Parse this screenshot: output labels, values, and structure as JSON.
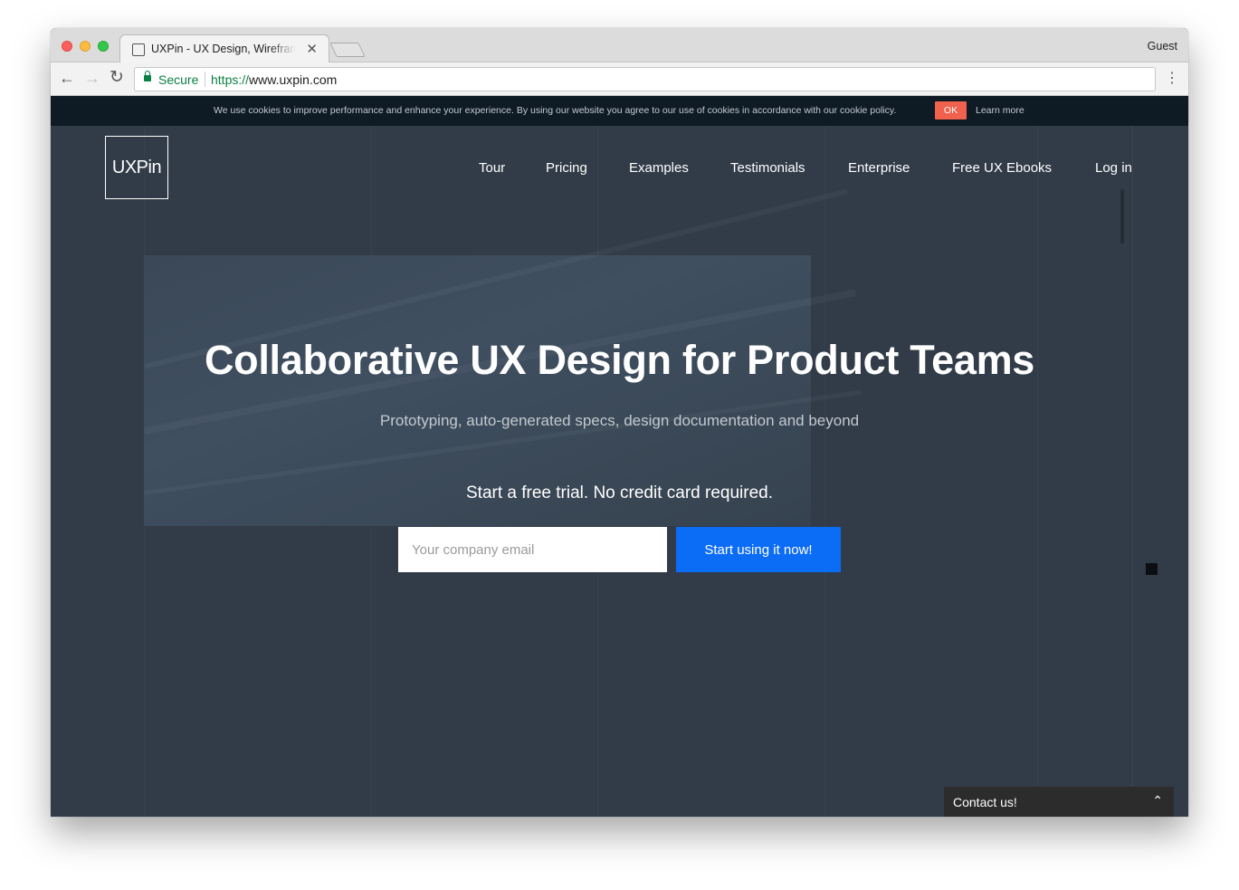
{
  "browser": {
    "tab_title": "UXPin - UX Design, Wireframing",
    "tab_close": "✕",
    "profile": "Guest",
    "secure_label": "Secure",
    "url_scheme": "https://",
    "url_host": "www.uxpin.com",
    "nav_back_icon": "←",
    "nav_forward_icon": "→",
    "reload_icon": "↻",
    "menu_icon": "⋮"
  },
  "cookie": {
    "text": "We use cookies to improve performance and enhance your experience. By using our website you agree to our use of cookies in accordance with our cookie policy.",
    "ok_label": "OK",
    "learn_more": "Learn more"
  },
  "header": {
    "logo": "UXPin",
    "nav": [
      "Tour",
      "Pricing",
      "Examples",
      "Testimonials",
      "Enterprise",
      "Free UX Ebooks",
      "Log in"
    ]
  },
  "hero": {
    "title": "Collaborative UX Design for Product Teams",
    "subtitle": "Prototyping, auto-generated specs, design documentation and beyond",
    "trial_text": "Start a free trial. No credit card required.",
    "email_placeholder": "Your company email",
    "cta_label": "Start using it now!"
  },
  "contact": {
    "label": "Contact us!",
    "chevron": "⌃"
  },
  "colors": {
    "cta": "#0b6cf5",
    "cookie_ok": "#f0614e",
    "secure": "#0b8043",
    "overlay": "#313c48"
  }
}
